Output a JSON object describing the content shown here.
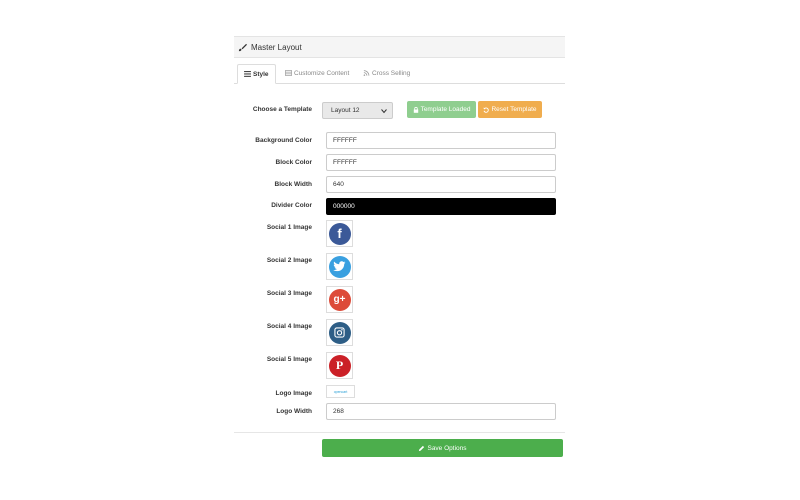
{
  "panel": {
    "title": "Master Layout",
    "icon": "paintbrush-icon"
  },
  "tabs": [
    {
      "label": "Style",
      "icon": "list-icon",
      "active": true
    },
    {
      "label": "Customize Content",
      "icon": "table-icon",
      "active": false
    },
    {
      "label": "Cross Selling",
      "icon": "rss-icon",
      "active": false
    }
  ],
  "template": {
    "label": "Choose a Template",
    "selected": "Layout 12",
    "loaded_button": "Template Loaded",
    "reset_button": "Reset Template"
  },
  "fields": {
    "background_color": {
      "label": "Background Color",
      "value": "FFFFFF"
    },
    "block_color": {
      "label": "Block Color",
      "value": "FFFFFF"
    },
    "block_width": {
      "label": "Block Width",
      "value": "640"
    },
    "divider_color": {
      "label": "Divider Color",
      "value": "000000"
    }
  },
  "social": [
    {
      "label": "Social 1 Image",
      "icon": "facebook-icon",
      "glyph": "f",
      "color": "#3b5998"
    },
    {
      "label": "Social 2 Image",
      "icon": "twitter-icon",
      "glyph": "t",
      "color": "#3aa0e0"
    },
    {
      "label": "Social 3 Image",
      "icon": "google-plus-icon",
      "glyph": "g+",
      "color": "#dd4b39"
    },
    {
      "label": "Social 4 Image",
      "icon": "instagram-icon",
      "glyph": "◎",
      "color": "#2e5e86"
    },
    {
      "label": "Social 5 Image",
      "icon": "pinterest-icon",
      "glyph": "P",
      "color": "#cb2027"
    }
  ],
  "logo": {
    "label": "Logo Image",
    "text": "opencart"
  },
  "logo_width": {
    "label": "Logo Width",
    "value": "268"
  },
  "save_button": "Save Options",
  "colors": {
    "success": "#4cae4c",
    "success_light": "#8fce8f",
    "warning": "#f0ad4e"
  }
}
